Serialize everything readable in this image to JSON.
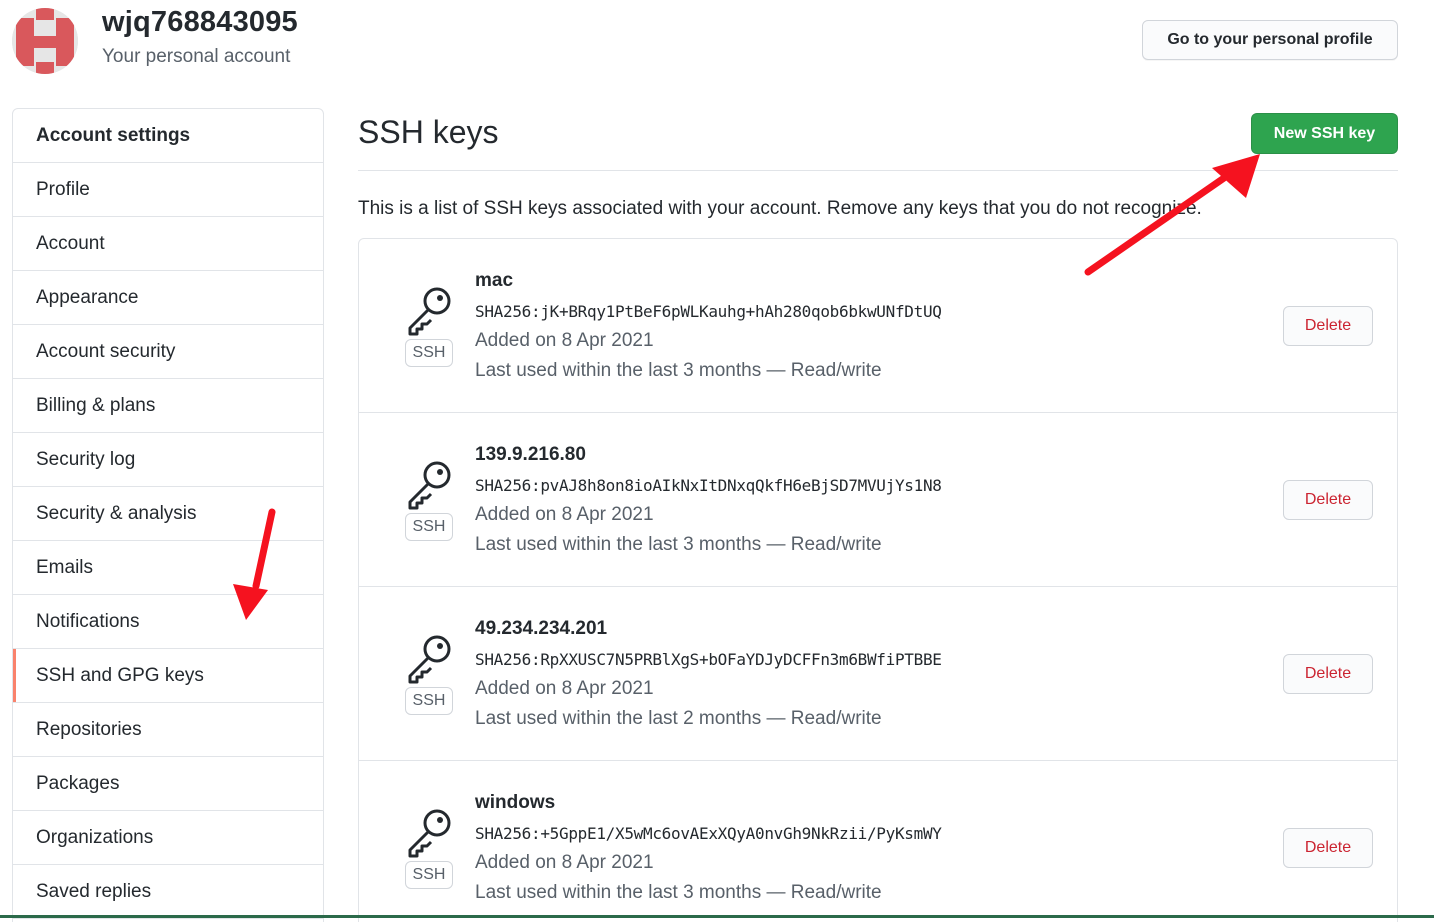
{
  "header": {
    "username": "wjq768843095",
    "subtitle": "Your personal account",
    "profile_button": "Go to your personal profile"
  },
  "sidebar": {
    "heading": "Account settings",
    "items": [
      {
        "label": "Profile",
        "selected": false
      },
      {
        "label": "Account",
        "selected": false
      },
      {
        "label": "Appearance",
        "selected": false
      },
      {
        "label": "Account security",
        "selected": false
      },
      {
        "label": "Billing & plans",
        "selected": false
      },
      {
        "label": "Security log",
        "selected": false
      },
      {
        "label": "Security & analysis",
        "selected": false
      },
      {
        "label": "Emails",
        "selected": false
      },
      {
        "label": "Notifications",
        "selected": false
      },
      {
        "label": "SSH and GPG keys",
        "selected": true
      },
      {
        "label": "Repositories",
        "selected": false
      },
      {
        "label": "Packages",
        "selected": false
      },
      {
        "label": "Organizations",
        "selected": false
      },
      {
        "label": "Saved replies",
        "selected": false
      }
    ]
  },
  "main": {
    "title": "SSH keys",
    "new_key_button": "New SSH key",
    "intro": "This is a list of SSH keys associated with your account. Remove any keys that you do not recognize.",
    "keys": [
      {
        "title": "mac",
        "fingerprint": "SHA256:jK+BRqy1PtBeF6pWLKauhg+hAh280qob6bkwUNfDtUQ",
        "added": "Added on 8 Apr 2021",
        "last_used": "Last used within the last 3 months — Read/write",
        "badge": "SSH",
        "delete_label": "Delete"
      },
      {
        "title": "139.9.216.80",
        "fingerprint": "SHA256:pvAJ8h8on8ioAIkNxItDNxqQkfH6eBjSD7MVUjYs1N8",
        "added": "Added on 8 Apr 2021",
        "last_used": "Last used within the last 3 months — Read/write",
        "badge": "SSH",
        "delete_label": "Delete"
      },
      {
        "title": "49.234.234.201",
        "fingerprint": "SHA256:RpXXUSC7N5PRBlXgS+bOFaYDJyDCFFn3m6BWfiPTBBE",
        "added": "Added on 8 Apr 2021",
        "last_used": "Last used within the last 2 months — Read/write",
        "badge": "SSH",
        "delete_label": "Delete"
      },
      {
        "title": "windows",
        "fingerprint": "SHA256:+5GppE1/X5wMc6ovAExXQyA0nvGh9NkRzii/PyKsmWY",
        "added": "Added on 8 Apr 2021",
        "last_used": "Last used within the last 3 months — Read/write",
        "badge": "SSH",
        "delete_label": "Delete"
      }
    ]
  },
  "icons": {
    "avatar": "identicon-avatar",
    "key": "key-icon",
    "annotation": "red-arrow"
  },
  "colors": {
    "primary_button": "#2ea44f",
    "danger_text": "#cb2431",
    "selected_marker": "#f9826c",
    "annotation_arrow": "#f5121f"
  }
}
